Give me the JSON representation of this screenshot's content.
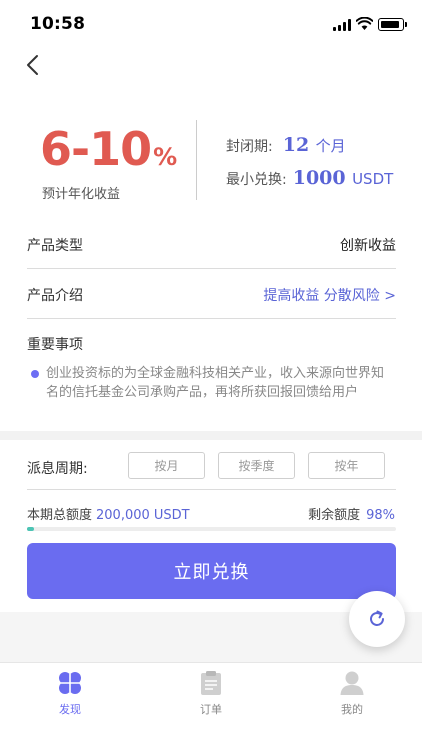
{
  "status_bar": {
    "time": "10:58"
  },
  "hero": {
    "rate": "6-10",
    "rate_suffix": "%",
    "rate_label": "预计年化收益",
    "lock_label": "封闭期:",
    "lock_value": "12",
    "lock_unit": "个月",
    "min_label": "最小兑换:",
    "min_value": "1000",
    "min_unit": "USDT"
  },
  "rows": {
    "type_label": "产品类型",
    "type_value": "创新收益",
    "intro_label": "产品介绍",
    "intro_value": "提高收益 分散风险 >"
  },
  "notes": {
    "title": "重要事项",
    "text": "创业投资标的为全球金融科技相关产业，收入来源向世界知名的信托基金公司承购产品，再将所获回报回馈给用户"
  },
  "payout": {
    "label": "派息周期:",
    "options": [
      "按月",
      "按季度",
      "按年"
    ]
  },
  "quota": {
    "total_label": "本期总额度",
    "total_value": "200,000 USDT",
    "remain_label": "剩余额度",
    "remain_value": "98%",
    "sold_fraction": 0.02
  },
  "cta_label": "立即兑换",
  "tabs": [
    {
      "label": "发现",
      "icon": "discover-icon",
      "active": true
    },
    {
      "label": "订单",
      "icon": "clipboard-icon",
      "active": false
    },
    {
      "label": "我的",
      "icon": "person-icon",
      "active": false
    }
  ],
  "colors": {
    "accent": "#6a6cf0",
    "rate": "#e05a51",
    "progress": "#4cc4b4"
  }
}
